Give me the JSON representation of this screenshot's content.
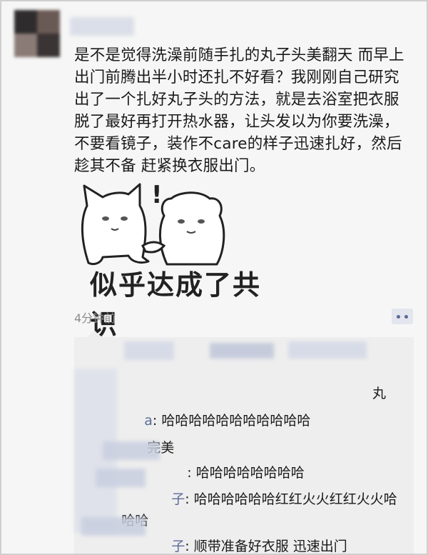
{
  "post": {
    "username": "",
    "text": "是不是觉得洗澡前随手扎的丸子头美翻天 而早上出门前腾出半小时还扎不好看？我刚刚自己研究出了一个扎好丸子头的方法，就是去浴室把衣服脱了最好再打开热水器，让头发以为你要洗澡，不要看镜子，装作不care的样子迅速扎好，然后趁其不备 赶紧换衣服出门。",
    "meme_caption": "似乎达成了共识",
    "meme_exclaim": "!",
    "timestamp": "4分钟前"
  },
  "comments": {
    "top_line_tail": "丸",
    "items": [
      {
        "name_tail": "a",
        "text": ": 哈哈哈哈哈哈哈哈哈哈哈"
      },
      {
        "name_tail": "",
        "text": "完美"
      },
      {
        "name_tail": "",
        "text": ": 哈哈哈哈哈哈哈哈"
      },
      {
        "name_tail": "子",
        "text": ": 哈哈哈哈哈哈红红火火红红火火哈"
      },
      {
        "name_tail": "",
        "text": "哈哈"
      },
      {
        "name_tail": "子",
        "text": ": 顺带准备好衣服 迅速出门"
      }
    ]
  },
  "colors": {
    "name_link": "#5a6b99",
    "timestamp": "#8c8c8c",
    "comment_bg": "#eeeeee"
  }
}
